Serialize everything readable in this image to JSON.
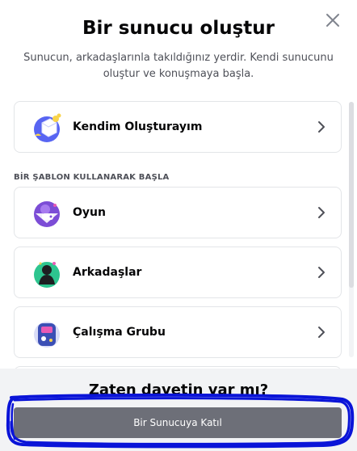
{
  "modal": {
    "title": "Bir sunucu oluştur",
    "subtitle": "Sunucun, arkadaşlarınla takıldığınız yerdir. Kendi sunucunu oluştur ve konuşmaya başla."
  },
  "options": {
    "create_own": {
      "label": "Kendim Oluşturayım",
      "icon": "create-server-icon"
    },
    "section_header": "BİR ŞABLON KULLANARAK BAŞLA",
    "templates": [
      {
        "label": "Oyun",
        "icon": "gaming-icon"
      },
      {
        "label": "Arkadaşlar",
        "icon": "friends-icon"
      },
      {
        "label": "Çalışma Grubu",
        "icon": "study-group-icon"
      }
    ]
  },
  "footer": {
    "title": "Zaten davetin var mı?",
    "join_button_label": "Bir Sunucuya Katıl"
  },
  "colors": {
    "annotation_outline": "#0a14d8",
    "join_button": "#6d6f78",
    "footer_bg": "#f2f3f5"
  }
}
